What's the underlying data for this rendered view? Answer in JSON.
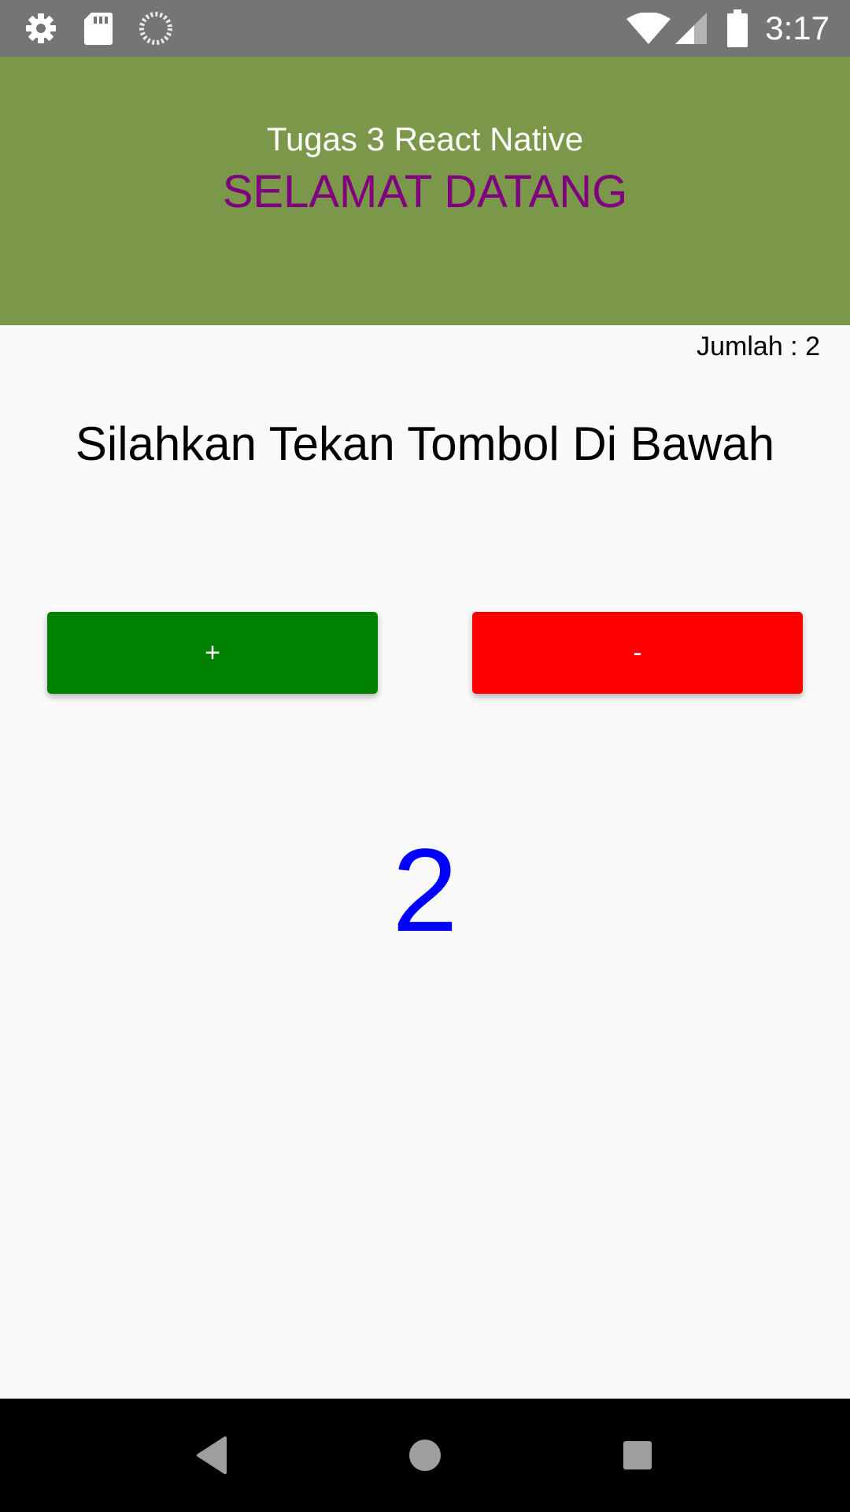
{
  "status_bar": {
    "time": "3:17",
    "left_icons": [
      "gear-icon",
      "sd-card-icon",
      "sync-icon"
    ],
    "right_icons": [
      "wifi-icon",
      "cell-signal-icon",
      "battery-icon"
    ]
  },
  "header": {
    "title": "Tugas 3 React Native",
    "subtitle": "SELAMAT DATANG",
    "background_color": "#7b984a",
    "subtitle_color": "#800080"
  },
  "counter": {
    "label": "Jumlah :",
    "value": "2"
  },
  "instruction": "Silahkan Tekan Tombol Di Bawah",
  "buttons": {
    "increment_label": "+",
    "increment_color": "#008000",
    "decrement_label": "-",
    "decrement_color": "#ff0000"
  },
  "display": {
    "value": "2",
    "color": "#0000ff"
  },
  "nav_bar": {
    "icons": [
      "back-icon",
      "home-icon",
      "recents-icon"
    ]
  }
}
